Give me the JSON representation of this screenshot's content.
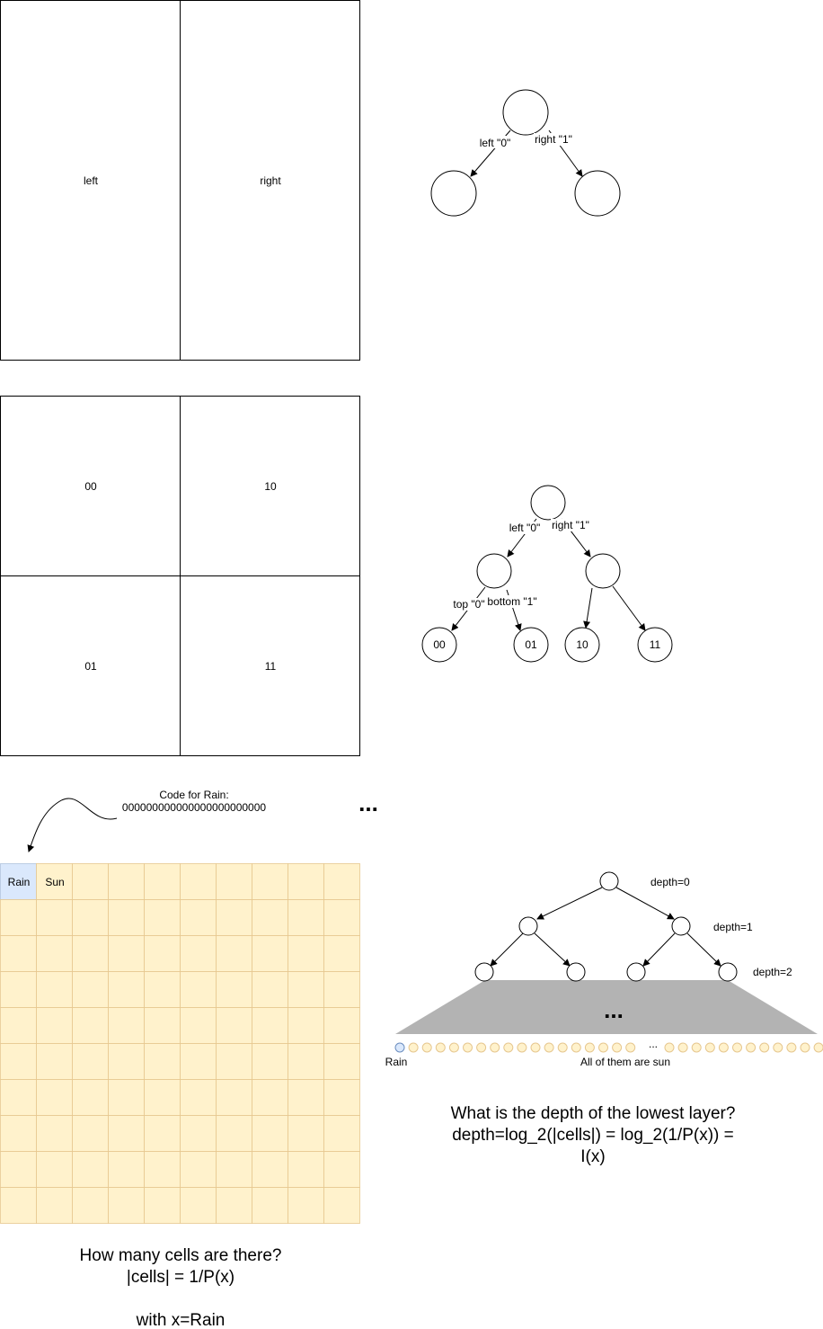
{
  "section1": {
    "left_label": "left",
    "right_label": "right",
    "edge_left": "left \"0\"",
    "edge_right": "right \"1\""
  },
  "section2": {
    "cell_00": "00",
    "cell_10": "10",
    "cell_01": "01",
    "cell_11": "11",
    "edge_left": "left \"0\"",
    "edge_right": "right \"1\"",
    "edge_top": "top \"0\"",
    "edge_bottom": "bottom \"1\"",
    "leaf_00": "00",
    "leaf_01": "01",
    "leaf_10": "10",
    "leaf_11": "11"
  },
  "section3": {
    "code_title": "Code for Rain:",
    "code_value": "000000000000000000000000",
    "ellipsis": "...",
    "rain_cell": "Rain",
    "sun_cell": "Sun",
    "question_line1": "How many cells are there?",
    "question_line2": "|cells| = 1/P(x)",
    "question_line3": "with x=Rain"
  },
  "tree3": {
    "depth0": "depth=0",
    "depth1": "depth=1",
    "depth2": "depth=2",
    "ellipsis": "...",
    "leaf_gap": "...",
    "rain_label": "Rain",
    "sun_label": "All of them are sun",
    "question_line1": "What is the depth of the lowest layer?",
    "question_line2": "depth=log_2(|cells|) = log_2(1/P(x)) =",
    "question_line3": "I(x)"
  },
  "colors": {
    "sun": "#fff2cc",
    "rain": "#dae8fc",
    "trapezoid": "#b3b3b3"
  }
}
